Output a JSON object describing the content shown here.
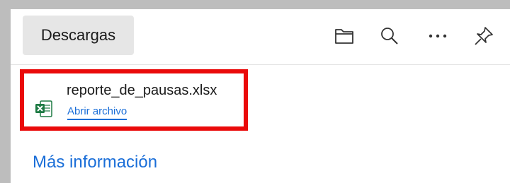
{
  "header": {
    "title": "Descargas",
    "icons": [
      "open-folder-icon",
      "search-icon",
      "more-options-icon",
      "pin-icon"
    ]
  },
  "download_item": {
    "file_name": "reporte_de_pausas.xlsx",
    "file_icon": "excel-file-icon",
    "action_label": "Abrir archivo"
  },
  "footer": {
    "more_info_label": "Más información"
  },
  "colors": {
    "highlight": "#ea0a0a",
    "link": "#1a6ed8",
    "excel_green": "#1d7a43"
  }
}
